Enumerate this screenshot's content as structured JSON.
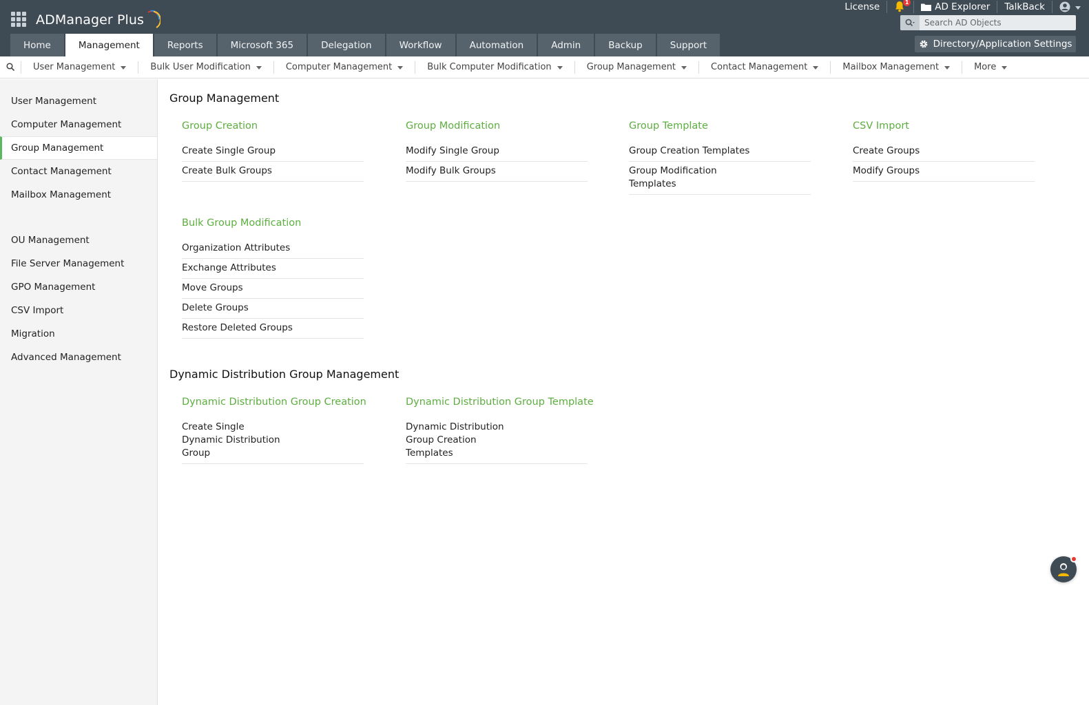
{
  "app": {
    "name": "ADManager Plus"
  },
  "header": {
    "links": {
      "license": "License",
      "notification_count": "1",
      "ad_explorer": "AD Explorer",
      "talkback": "TalkBack"
    },
    "search": {
      "placeholder": "Search AD Objects"
    },
    "settings_button": "Directory/Application Settings",
    "tabs": [
      {
        "label": "Home"
      },
      {
        "label": "Management",
        "active": true
      },
      {
        "label": "Reports"
      },
      {
        "label": "Microsoft 365"
      },
      {
        "label": "Delegation"
      },
      {
        "label": "Workflow"
      },
      {
        "label": "Automation"
      },
      {
        "label": "Admin"
      },
      {
        "label": "Backup"
      },
      {
        "label": "Support"
      }
    ]
  },
  "subnav": {
    "items": [
      {
        "label": "User Management"
      },
      {
        "label": "Bulk User Modification"
      },
      {
        "label": "Computer Management"
      },
      {
        "label": "Bulk Computer Modification"
      },
      {
        "label": "Group Management"
      },
      {
        "label": "Contact Management"
      },
      {
        "label": "Mailbox Management"
      },
      {
        "label": "More"
      }
    ]
  },
  "sidebar": {
    "items": [
      {
        "label": "User Management"
      },
      {
        "label": "Computer Management"
      },
      {
        "label": "Group Management",
        "active": true
      },
      {
        "label": "Contact Management"
      },
      {
        "label": "Mailbox Management"
      },
      {
        "label": "OU Management"
      },
      {
        "label": "File Server Management"
      },
      {
        "label": "GPO Management"
      },
      {
        "label": "CSV Import"
      },
      {
        "label": "Migration"
      },
      {
        "label": "Advanced Management"
      }
    ]
  },
  "main": {
    "sections": [
      {
        "title": "Group Management",
        "columns": [
          {
            "title": "Group Creation",
            "links": [
              "Create Single Group",
              "Create Bulk Groups"
            ]
          },
          {
            "title": "Group Modification",
            "links": [
              "Modify Single Group",
              "Modify Bulk Groups"
            ]
          },
          {
            "title": "Group Template",
            "links": [
              "Group Creation Templates",
              "Group Modification Templates"
            ]
          },
          {
            "title": "CSV Import",
            "links": [
              "Create Groups",
              "Modify Groups"
            ]
          },
          {
            "title": "Bulk Group Modification",
            "links": [
              "Organization Attributes",
              "Exchange Attributes",
              "Move Groups",
              "Delete Groups",
              "Restore Deleted Groups"
            ]
          }
        ]
      },
      {
        "title": "Dynamic Distribution Group Management",
        "columns": [
          {
            "title": "Dynamic Distribution Group Creation",
            "links": [
              "Create Single Dynamic Distribution Group"
            ]
          },
          {
            "title": "Dynamic Distribution Group Template",
            "links": [
              "Dynamic Distribution Group Creation Templates"
            ]
          }
        ]
      }
    ]
  },
  "colors": {
    "header_bg": "#3e4a54",
    "tab_bg": "#56636d",
    "accent_green": "#5cae3f",
    "active_marker": "#5cb85c",
    "badge_red": "#e53935"
  }
}
